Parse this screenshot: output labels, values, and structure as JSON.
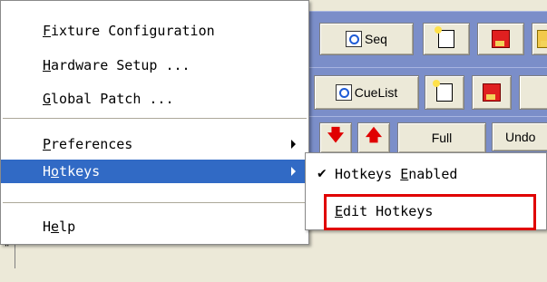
{
  "toolbar": {
    "row1": {
      "seq_label": "Seq"
    },
    "row2": {
      "cuelist_label": "CueList"
    },
    "row3": {
      "full_label": "Full",
      "undo_label": "Undo"
    }
  },
  "menu": {
    "items": [
      {
        "first": "F",
        "rest": "ixture Configuration"
      },
      {
        "first": "H",
        "rest": "ardware Setup ..."
      },
      {
        "first": "G",
        "rest": "lobal Patch ..."
      },
      {
        "first": "P",
        "rest": "references"
      },
      {
        "before": "H",
        "u": "o",
        "after": "tkeys"
      },
      {
        "before": "H",
        "u": "e",
        "after": "lp"
      }
    ]
  },
  "submenu": {
    "enabled": {
      "before": "Hotkeys ",
      "u": "E",
      "after": "nabled",
      "checked": true
    },
    "edit": {
      "u": "E",
      "after": "dit Hotkeys"
    }
  },
  "status": {
    "marker": "\""
  },
  "colors": {
    "highlight_box": "#e00000",
    "menu_selection": "#316ac5",
    "toolbar_band": "#7b8ec9"
  }
}
